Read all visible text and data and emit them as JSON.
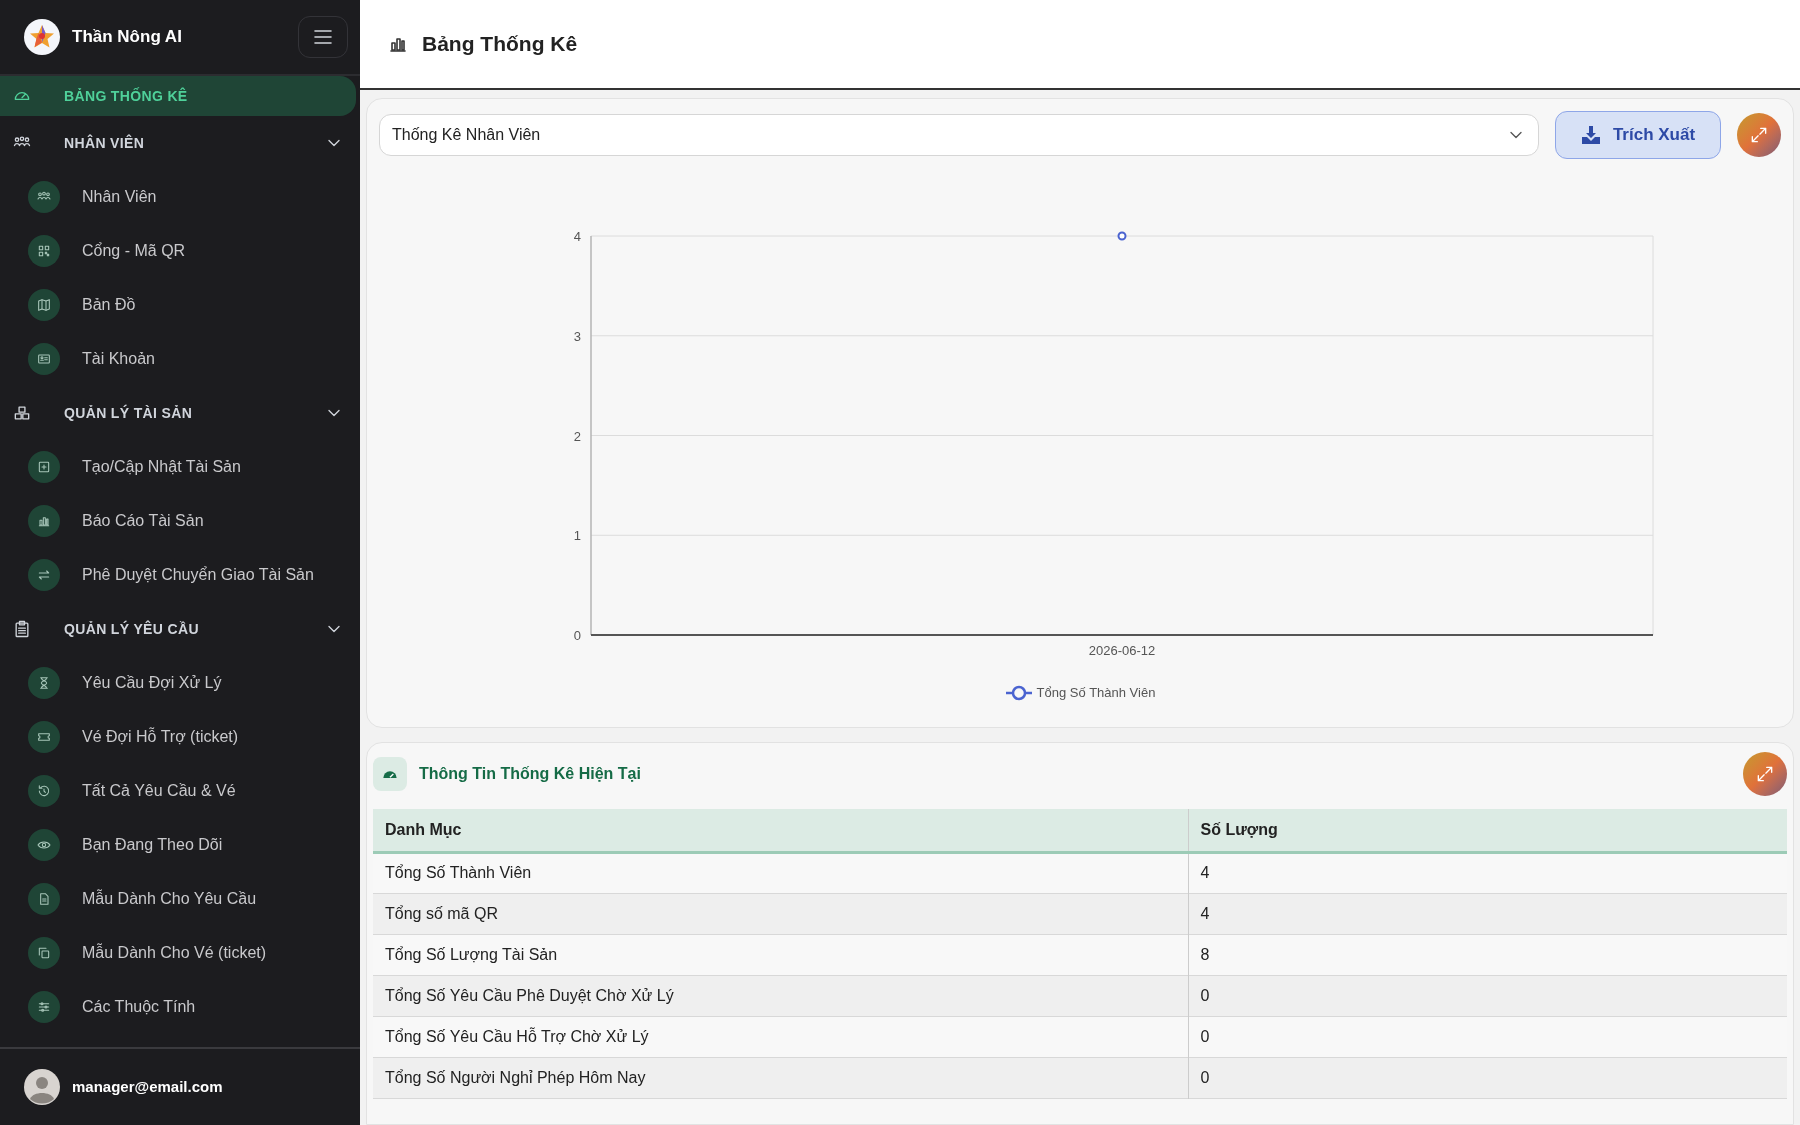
{
  "sidebar": {
    "brand": "Thần Nông AI",
    "nav": [
      {
        "kind": "link",
        "label": "BẢNG THỐNG KÊ",
        "selected": true
      },
      {
        "kind": "group",
        "label": "NHÂN VIÊN",
        "expanded": true,
        "children": [
          {
            "label": "Nhân Viên"
          },
          {
            "label": "Cổng - Mã QR"
          },
          {
            "label": "Bản Đồ"
          },
          {
            "label": "Tài Khoản"
          }
        ]
      },
      {
        "kind": "group",
        "label": "QUẢN LÝ TÀI SẢN",
        "expanded": true,
        "children": [
          {
            "label": "Tạo/Cập Nhật Tài Sản"
          },
          {
            "label": "Báo Cáo Tài Sản"
          },
          {
            "label": "Phê Duyệt Chuyển Giao Tài Sản"
          }
        ]
      },
      {
        "kind": "group",
        "label": "QUẢN LÝ YÊU CẦU",
        "expanded": true,
        "children": [
          {
            "label": "Yêu Cầu Đợi Xử Lý"
          },
          {
            "label": "Vé Đợi Hỗ Trợ (ticket)"
          },
          {
            "label": "Tất Cả Yêu Cầu & Vé"
          },
          {
            "label": "Bạn Đang Theo Dõi"
          },
          {
            "label": "Mẫu Dành Cho Yêu Cầu"
          },
          {
            "label": "Mẫu Dành Cho Vé (ticket)"
          },
          {
            "label": "Các Thuộc Tính"
          }
        ]
      }
    ],
    "user": "manager@email.com"
  },
  "header": {
    "title": "Bảng Thống Kê"
  },
  "chart_card": {
    "select": "Thống Kê Nhân Viên",
    "export_button": "Trích Xuất",
    "chart_data": {
      "type": "line",
      "grid": true,
      "categories": [
        "2026-06-12"
      ],
      "series": [
        {
          "name": "Tổng Số Thành Viên",
          "color": "#4a63d0",
          "marker": "circle",
          "values": [
            4
          ]
        }
      ],
      "ylim": [
        0,
        4
      ],
      "yticks": [
        0,
        1,
        2,
        3,
        4
      ]
    }
  },
  "stats_card": {
    "title": "Thông Tin Thống Kê Hiện Tại",
    "columns": [
      "Danh Mục",
      "Số Lượng"
    ],
    "rows": [
      [
        "Tổng Số Thành Viên",
        "4"
      ],
      [
        "Tổng số mã QR",
        "4"
      ],
      [
        "Tổng Số Lượng Tài Sản",
        "8"
      ],
      [
        "Tổng Số Yêu Cầu Phê Duyệt Chờ Xử Lý",
        "0"
      ],
      [
        "Tổng Số Yêu Cầu Hỗ Trợ Chờ Xử Lý",
        "0"
      ],
      [
        "Tổng Số Người Nghỉ Phép Hôm Nay",
        "0"
      ]
    ]
  }
}
